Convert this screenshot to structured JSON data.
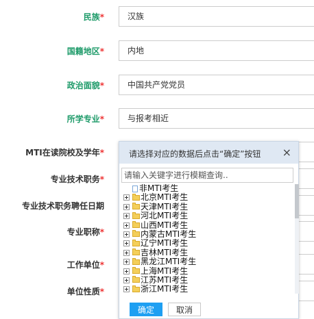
{
  "form": {
    "ethnicity": {
      "label": "民族",
      "required_mark": "*",
      "value": "汉族"
    },
    "nationality": {
      "label": "国籍地区",
      "required_mark": "*",
      "value": "内地"
    },
    "political": {
      "label": "政治面貌",
      "required_mark": "*",
      "value": "中国共产党党员"
    },
    "major": {
      "label": "所学专业",
      "required_mark": "*",
      "value": "与报考相近"
    },
    "mti_school": {
      "label": "MTI在读院校及学年",
      "required_mark": "*"
    },
    "tech_post": {
      "label": "专业技术职务",
      "required_mark": "*"
    },
    "tech_post_date": {
      "label": "专业技术职务聘任日期"
    },
    "title": {
      "label": "专业职称",
      "required_mark": "*"
    },
    "work_unit": {
      "label": "工作单位",
      "required_mark": "*"
    },
    "unit_type": {
      "label": "单位性质",
      "required_mark": "*"
    }
  },
  "dialog": {
    "title": "请选择对应的数据后点击“确定”按钮",
    "close_glyph": "×",
    "search_placeholder": "请输入关键字进行模糊查询..",
    "items": [
      {
        "label": "非MTI考生",
        "type": "file"
      },
      {
        "label": "北京MTI考生",
        "type": "folder"
      },
      {
        "label": "天津MTI考生",
        "type": "folder"
      },
      {
        "label": "河北MTI考生",
        "type": "folder"
      },
      {
        "label": "山西MTI考生",
        "type": "folder"
      },
      {
        "label": "内蒙古MTI考生",
        "type": "folder"
      },
      {
        "label": "辽宁MTI考生",
        "type": "folder"
      },
      {
        "label": "吉林MTI考生",
        "type": "folder"
      },
      {
        "label": "黑龙江MTI考生",
        "type": "folder"
      },
      {
        "label": "上海MTI考生",
        "type": "folder"
      },
      {
        "label": "江苏MTI考生",
        "type": "folder"
      },
      {
        "label": "浙江MTI考生",
        "type": "folder"
      }
    ],
    "ok_label": "确定",
    "cancel_label": "取消"
  }
}
